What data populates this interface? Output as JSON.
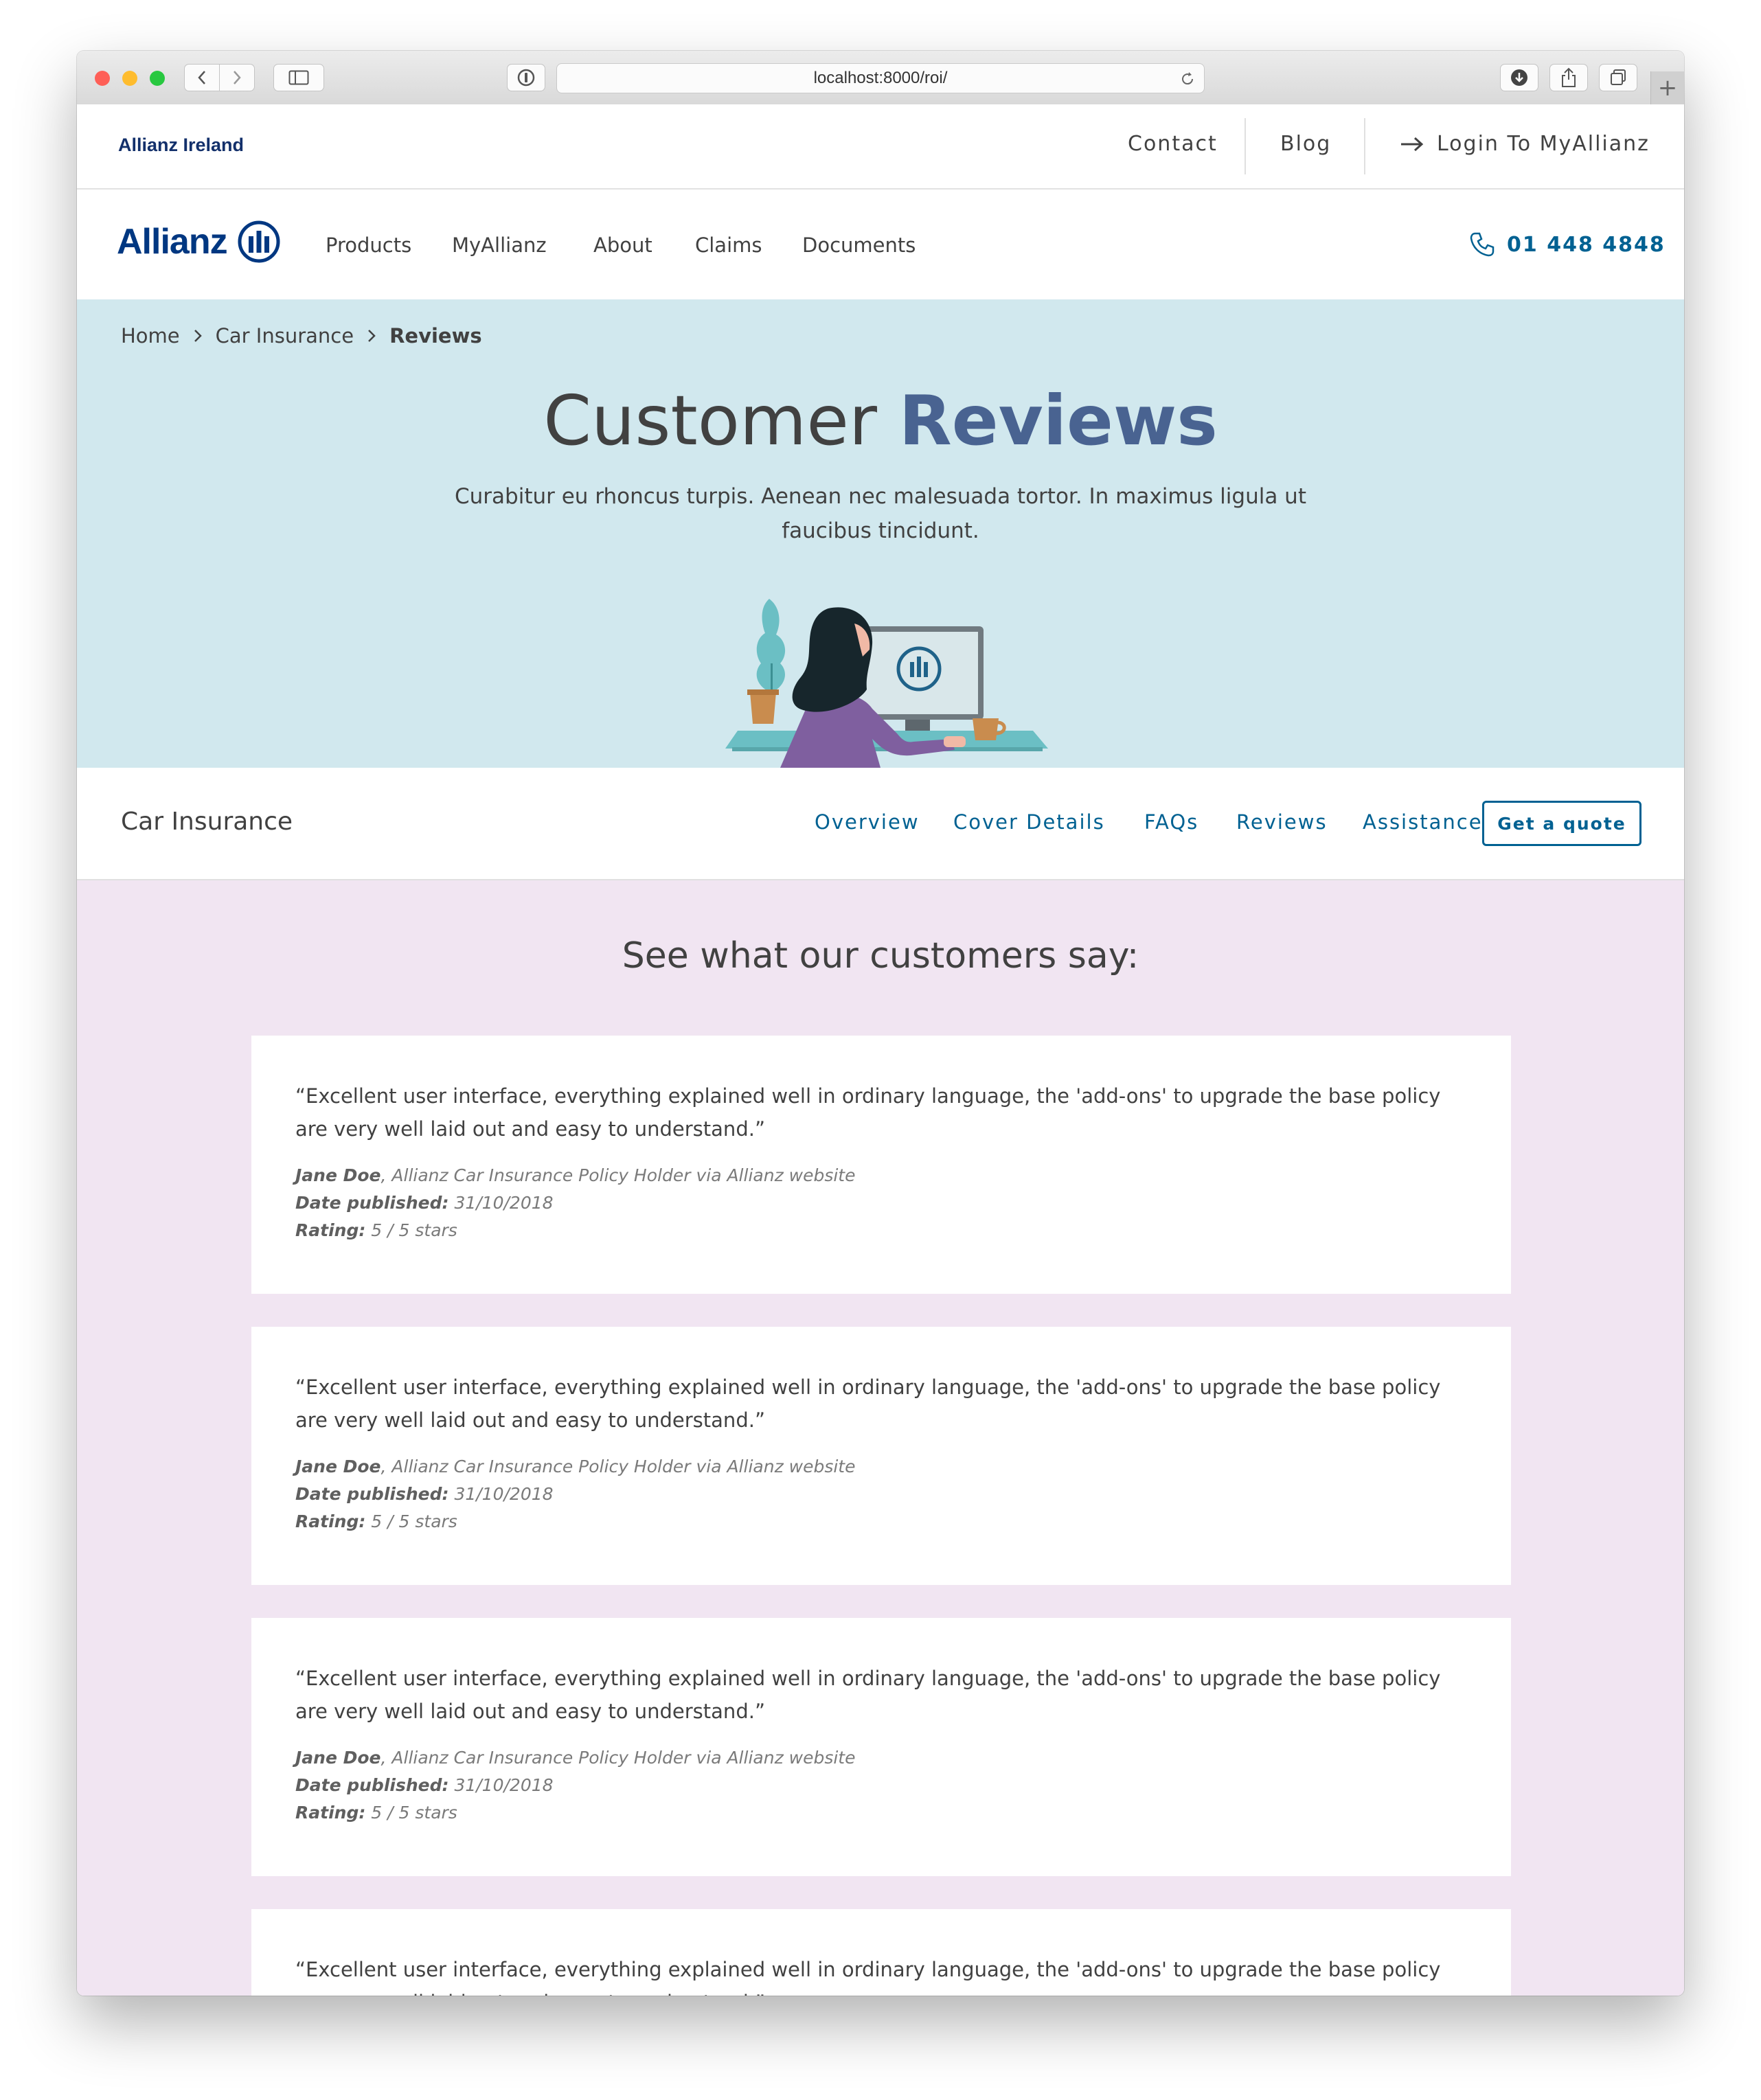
{
  "browser": {
    "url": "localhost:8000/roi/",
    "traffic_lights": [
      "#fe5f57",
      "#febc2e",
      "#28c840"
    ]
  },
  "topbar": {
    "brand": "Allianz Ireland",
    "links": {
      "contact": "Contact",
      "blog": "Blog",
      "login": "Login To MyAllianz"
    }
  },
  "nav": {
    "logo": "Allianz",
    "items": [
      "Products",
      "MyAllianz",
      "About",
      "Claims",
      "Documents"
    ],
    "phone": "01 448 4848"
  },
  "breadcrumb": {
    "items": [
      "Home",
      "Car Insurance",
      "Reviews"
    ]
  },
  "hero": {
    "title_plain": "Customer ",
    "title_accent": "Reviews",
    "subtitle_line1": "Curabitur eu rhoncus turpis. Aenean nec malesuada tortor. In maximus ligula ut",
    "subtitle_line2": "faucibus tincidunt."
  },
  "subnav": {
    "title": "Car Insurance",
    "links": [
      "Overview",
      "Cover Details",
      "FAQs",
      "Reviews",
      "Assistance"
    ],
    "cta": "Get a quote"
  },
  "reviews": {
    "heading": "See what our customers say:",
    "items": [
      {
        "quote": "“Excellent user interface, everything explained well in ordinary language, the 'add-ons' to upgrade the base policy are very well laid out and easy to understand.”",
        "author": "Jane Doe",
        "source": ", Allianz Car Insurance Policy Holder via Allianz website",
        "date_label": "Date published:",
        "date": " 31/10/2018",
        "rating_label": "Rating:",
        "rating": " 5 / 5 stars"
      },
      {
        "quote": "“Excellent user interface, everything explained well in ordinary language, the 'add-ons' to upgrade the base policy are very well laid out and easy to understand.”",
        "author": "Jane Doe",
        "source": ", Allianz Car Insurance Policy Holder via Allianz website",
        "date_label": "Date published:",
        "date": " 31/10/2018",
        "rating_label": "Rating:",
        "rating": " 5 / 5 stars"
      },
      {
        "quote": "“Excellent user interface, everything explained well in ordinary language, the 'add-ons' to upgrade the base policy are very well laid out and easy to understand.”",
        "author": "Jane Doe",
        "source": ", Allianz Car Insurance Policy Holder via Allianz website",
        "date_label": "Date published:",
        "date": " 31/10/2018",
        "rating_label": "Rating:",
        "rating": " 5 / 5 stars"
      },
      {
        "quote": "“Excellent user interface, everything explained well in ordinary language, the 'add-ons' to upgrade the base policy are very well laid out and easy to understand.”"
      }
    ]
  }
}
